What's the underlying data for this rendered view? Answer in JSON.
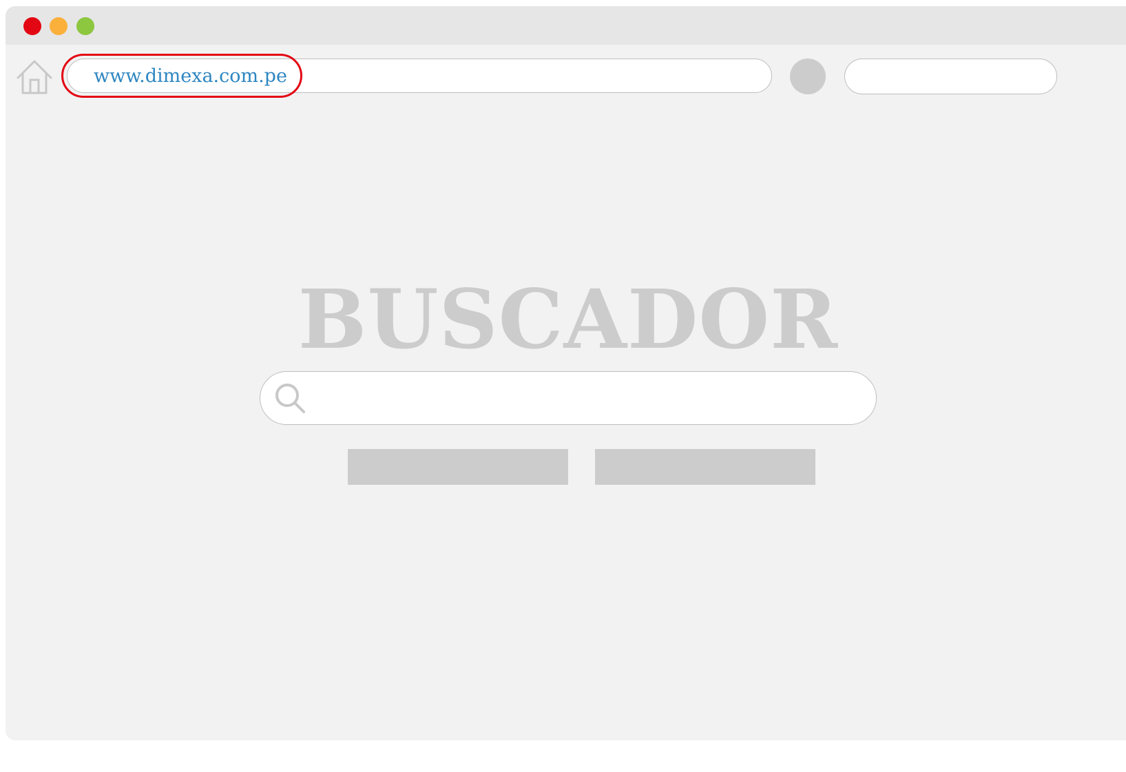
{
  "window": {
    "controls": [
      "close",
      "minimize",
      "maximize"
    ],
    "colors": {
      "close": "#e30613",
      "minimize": "#fbb03b",
      "maximize": "#8dc63f",
      "frame": "#f2f2f2",
      "titlebar": "#e6e6e6"
    }
  },
  "toolbar": {
    "home_icon": "home-icon",
    "url": "www.dimexa.com.pe",
    "url_color": "#2e86c1",
    "url_highlight_color": "#e30613"
  },
  "main": {
    "title": "BUSCADOR",
    "title_color": "#cccccc",
    "search_icon": "search-icon",
    "buttons": [
      "",
      ""
    ]
  }
}
